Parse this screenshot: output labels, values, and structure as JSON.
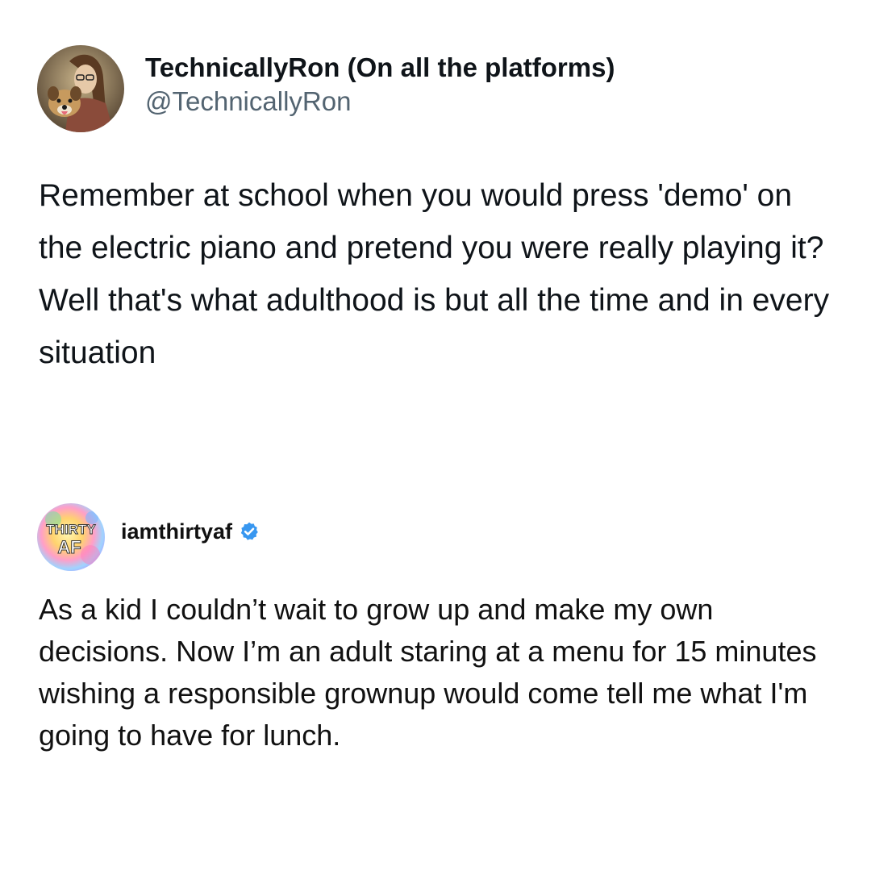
{
  "tweet": {
    "display_name": "TechnicallyRon (On all the platforms)",
    "handle": "@TechnicallyRon",
    "text": "Remember at school when you would press 'demo' on the electric piano and pretend you were really playing it? Well that's what adulthood is but all the time and in every situation"
  },
  "instagram": {
    "avatar_text_top": "THIRTY",
    "avatar_text_bottom": "AF",
    "username": "iamthirtyaf",
    "verified_icon": "verified-badge-icon",
    "text": "As a kid I couldn’t wait to grow up and make my own decisions. Now I’m an adult staring at a menu for 15 minutes wishing a responsible grownup would come tell me what I'm going to have for lunch."
  },
  "colors": {
    "text_primary": "#0f1419",
    "text_secondary": "#536471",
    "verified_blue": "#3897f0"
  }
}
